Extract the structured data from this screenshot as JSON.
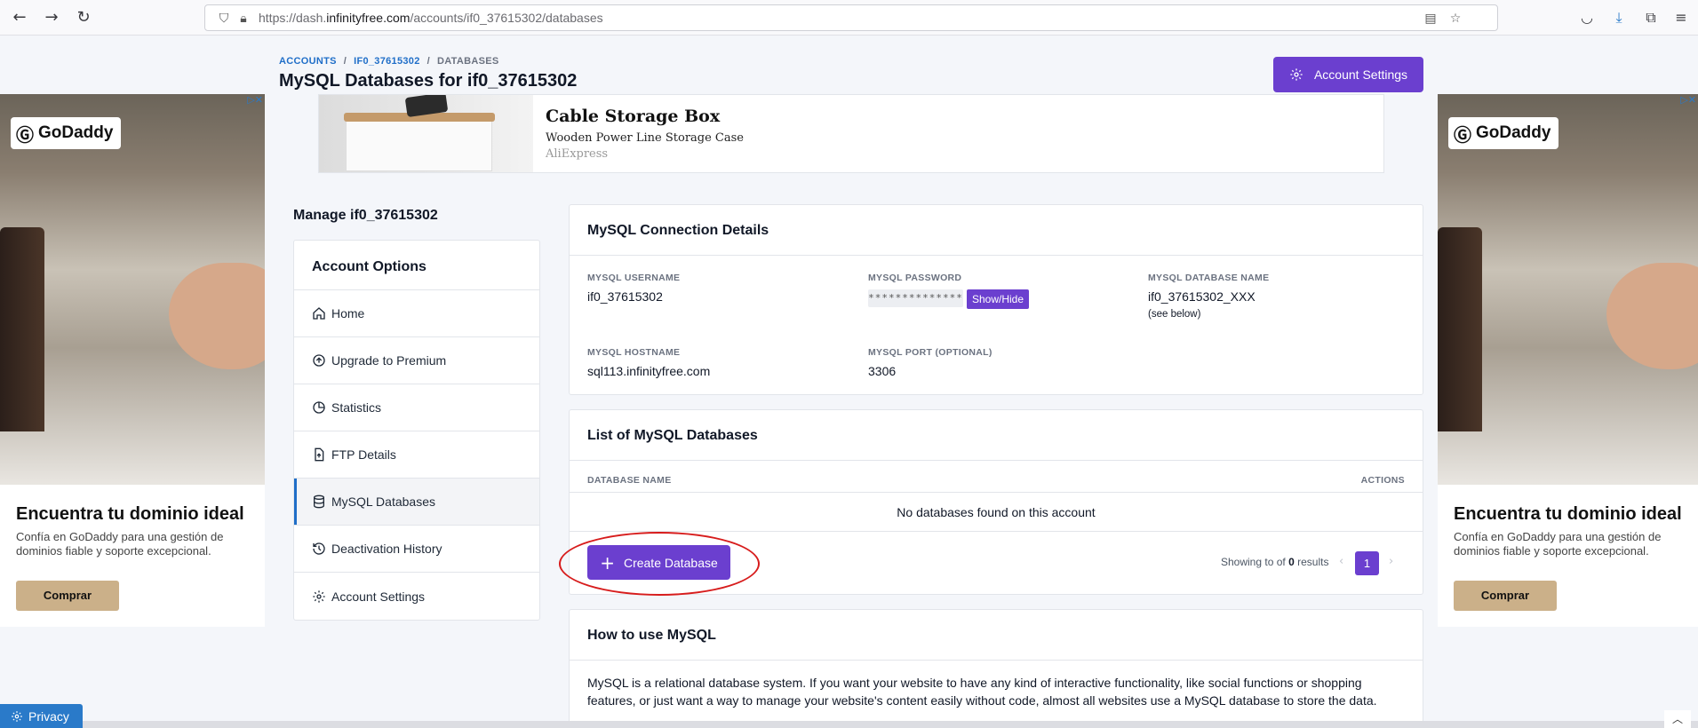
{
  "browser": {
    "url_prefix": "https://dash.",
    "url_domain": "infinityfree.com",
    "url_path": "/accounts/if0_37615302/databases"
  },
  "breadcrumb": {
    "accounts": "ACCOUNTS",
    "account": "IF0_37615302",
    "current": "DATABASES",
    "separator": "/"
  },
  "header": {
    "title": "MySQL Databases for if0_37615302",
    "account_settings_label": "Account Settings"
  },
  "top_ad": {
    "title": "Cable Storage Box",
    "subtitle": "Wooden Power Line Storage Case",
    "source": "AliExpress"
  },
  "side_ad": {
    "brand": "GoDaddy",
    "headline": "Encuentra tu dominio ideal",
    "body": "Confía en GoDaddy para una gestión de dominios fiable y soporte excepcional.",
    "button": "Comprar"
  },
  "sidebar": {
    "manage_title": "Manage if0_37615302",
    "options_title": "Account Options",
    "items": [
      {
        "label": "Home",
        "icon": "home-icon"
      },
      {
        "label": "Upgrade to Premium",
        "icon": "arrow-up-circle-icon"
      },
      {
        "label": "Statistics",
        "icon": "pie-chart-icon"
      },
      {
        "label": "FTP Details",
        "icon": "file-upload-icon"
      },
      {
        "label": "MySQL Databases",
        "icon": "database-icon",
        "active": true
      },
      {
        "label": "Deactivation History",
        "icon": "history-icon"
      },
      {
        "label": "Account Settings",
        "icon": "gear-icon"
      }
    ]
  },
  "connection": {
    "title": "MySQL Connection Details",
    "username_label": "MYSQL USERNAME",
    "username": "if0_37615302",
    "password_label": "MYSQL PASSWORD",
    "password_mask": "**************",
    "show_hide": "Show/Hide",
    "dbname_label": "MYSQL DATABASE NAME",
    "dbname": "if0_37615302_XXX",
    "dbname_note": "(see below)",
    "hostname_label": "MYSQL HOSTNAME",
    "hostname": "sql113.infinityfree.com",
    "port_label": "MYSQL PORT (OPTIONAL)",
    "port": "3306"
  },
  "db_list": {
    "title": "List of MySQL Databases",
    "col_name": "DATABASE NAME",
    "col_actions": "ACTIONS",
    "empty": "No databases found on this account",
    "create_button": "Create Database",
    "showing_prefix": "Showing to of",
    "showing_count": "0",
    "showing_suffix": "results",
    "page": "1",
    "prev": "‹",
    "next": "›"
  },
  "howto": {
    "title": "How to use MySQL",
    "text": "MySQL is a relational database system. If you want your website to have any kind of interactive functionality, like social functions or shopping features, or just want a way to manage your website's content easily without code, almost all websites use a MySQL database to store the data."
  },
  "privacy": {
    "label": "Privacy"
  },
  "colors": {
    "accent": "#6b3fcf",
    "link": "#1f6ec8",
    "highlight_ring": "#d71c1c"
  }
}
